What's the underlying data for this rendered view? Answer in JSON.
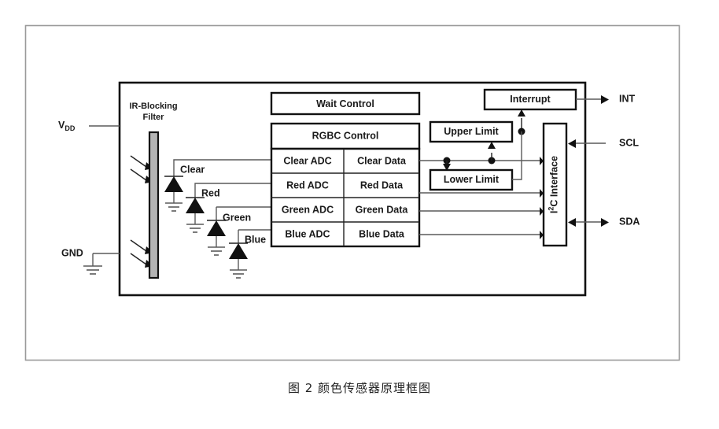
{
  "figure": {
    "caption": "图 2  颜色传感器原理框图",
    "caption_label": "图 2",
    "caption_title": "颜色传感器原理框图"
  },
  "colors": {
    "line": "#5a5a5a",
    "box_border": "#111111",
    "filter_fill": "#b4b4b4",
    "text": "#1a1a1a",
    "outer_frame": "#9a9a9a",
    "background": "#ffffff"
  },
  "pins": {
    "vdd": {
      "label": "V",
      "subscript": "DD"
    },
    "gnd": {
      "label": "GND"
    },
    "int": {
      "label": "INT"
    },
    "scl": {
      "label": "SCL"
    },
    "sda": {
      "label": "SDA"
    }
  },
  "filter": {
    "line1": "IR-Blocking",
    "line2": "Filter"
  },
  "photodiodes": [
    {
      "label": "Clear"
    },
    {
      "label": "Red"
    },
    {
      "label": "Green"
    },
    {
      "label": "Blue"
    }
  ],
  "blocks": {
    "wait_control": "Wait Control",
    "rgbc_control": "RGBC Control",
    "interrupt": "Interrupt",
    "upper_limit": "Upper Limit",
    "lower_limit": "Lower Limit",
    "i2c_interface": "I2C Interface",
    "i2c_interface_main": "I",
    "i2c_interface_sup": "2",
    "i2c_interface_rest": "C Interface"
  },
  "channel_rows": [
    {
      "adc": "Clear ADC",
      "data": "Clear Data"
    },
    {
      "adc": "Red ADC",
      "data": "Red Data"
    },
    {
      "adc": "Green ADC",
      "data": "Green Data"
    },
    {
      "adc": "Blue ADC",
      "data": "Blue Data"
    }
  ]
}
